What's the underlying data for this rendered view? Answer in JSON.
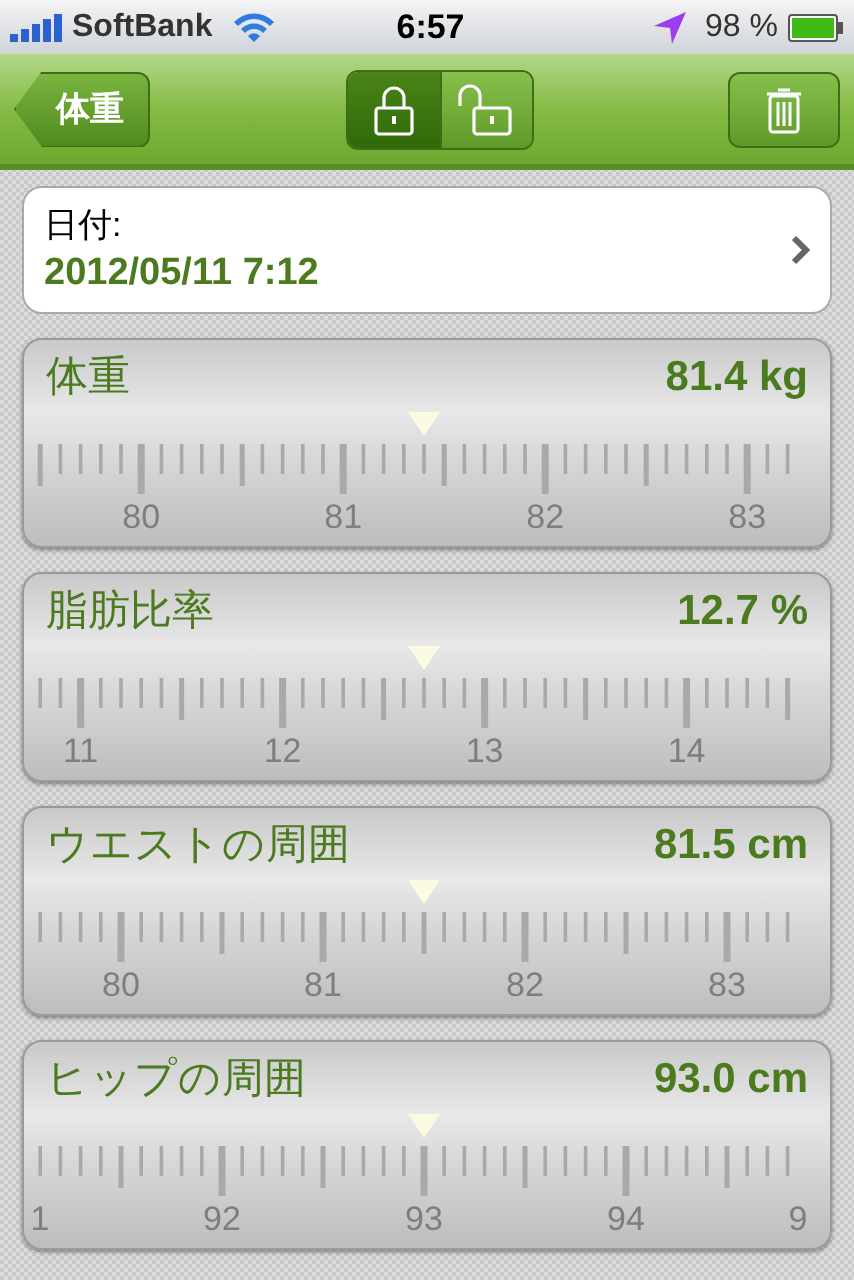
{
  "status_bar": {
    "carrier": "SoftBank",
    "time": "6:57",
    "battery": "98 %"
  },
  "nav_bar": {
    "back_button": "体重",
    "lock_segments": [
      {
        "kind": "locked",
        "selected": true
      },
      {
        "kind": "unlocked",
        "selected": false
      }
    ]
  },
  "date_card": {
    "label": "日付:",
    "value": "2012/05/11 7:12"
  },
  "rulers": [
    {
      "title": "体重",
      "reading": "81.4 kg",
      "labels": [
        "80",
        "81",
        "82",
        "83"
      ]
    },
    {
      "title": "脂肪比率",
      "reading": "12.7 %",
      "labels": [
        "11",
        "12",
        "13",
        "14"
      ]
    },
    {
      "title": "ウエストの周囲",
      "reading": "81.5 cm",
      "labels": [
        "80",
        "81",
        "82",
        "83"
      ]
    },
    {
      "title": "ヒップの周囲",
      "reading": "93.0 cm",
      "labels": [
        "1",
        "92",
        "93",
        "94",
        "9"
      ]
    }
  ]
}
